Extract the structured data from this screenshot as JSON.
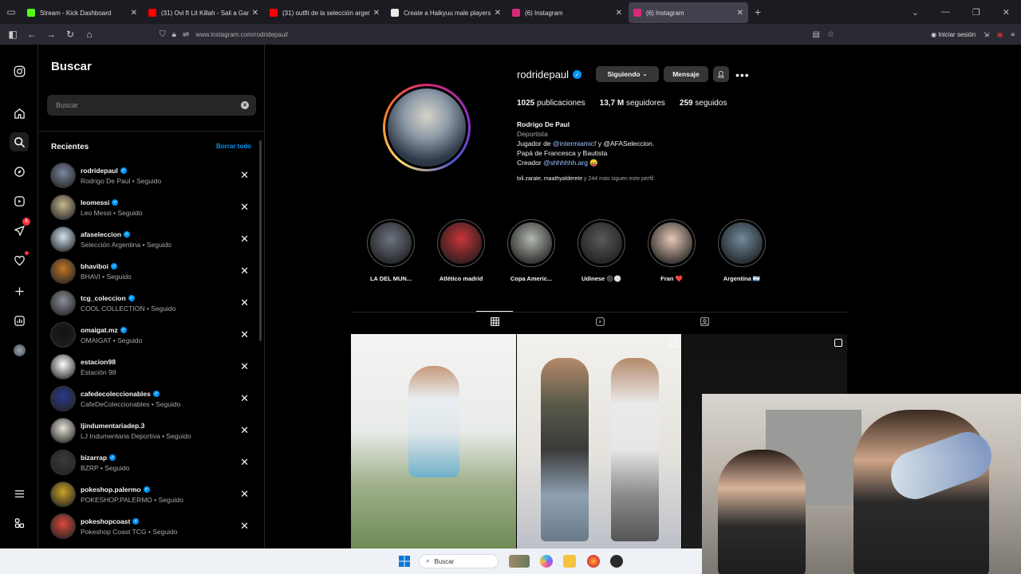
{
  "browser": {
    "tabs": [
      {
        "title": "Stream - Kick Dashboard",
        "color": "#53fc18",
        "active": false
      },
      {
        "title": "(31) Ovi ft Lit Killah - Sali a Gan",
        "color": "#ff0000",
        "active": false
      },
      {
        "title": "(31) outfit de la selección argen",
        "color": "#ff0000",
        "active": false
      },
      {
        "title": "Create a Haikyuu male players:",
        "color": "#e8e8e8",
        "active": false
      },
      {
        "title": "(6) Instagram",
        "color": "#d62976",
        "active": false
      },
      {
        "title": "(6) Instagram",
        "color": "#d62976",
        "active": true
      }
    ],
    "url": "www.instagram.com/rodridepaul/",
    "signin_label": "Iniciar sesión"
  },
  "search": {
    "title": "Buscar",
    "placeholder": "Buscar",
    "recent_heading": "Recientes",
    "clear_all": "Borrar todo",
    "items": [
      {
        "user": "rodridepaul",
        "sub": "Rodrigo De Paul • Seguido",
        "verified": true,
        "color": "#7a86a0"
      },
      {
        "user": "leomessi",
        "sub": "Leo Messi • Seguido",
        "verified": true,
        "color": "#c9b98f"
      },
      {
        "user": "afaseleccion",
        "sub": "Selección Argentina • Seguido",
        "verified": true,
        "color": "#cfe3f2"
      },
      {
        "user": "bhaviboi",
        "sub": "BHAVI • Seguido",
        "verified": true,
        "color": "#c2762b"
      },
      {
        "user": "tcg_coleccion",
        "sub": "COOL COLLECTION • Seguido",
        "verified": true,
        "color": "#8a8f99"
      },
      {
        "user": "omaigat.mz",
        "sub": "OMAIGAT • Seguido",
        "verified": true,
        "color": "#111111"
      },
      {
        "user": "estacion98",
        "sub": "Estación 98",
        "verified": false,
        "color": "#ffffff"
      },
      {
        "user": "cafedecoleccionables",
        "sub": "CafeDeColeccionables • Seguido",
        "verified": true,
        "color": "#2b3a8a"
      },
      {
        "user": "ljindumentariadep.3",
        "sub": "LJ Indumentaria Deportiva • Seguido",
        "verified": false,
        "color": "#e8e4d8"
      },
      {
        "user": "bizarrap",
        "sub": "BZRP • Seguido",
        "verified": true,
        "color": "#3a3a3a"
      },
      {
        "user": "pokeshop.palermo",
        "sub": "POKESHOP.PALERMO • Seguido",
        "verified": true,
        "color": "#c9a227"
      },
      {
        "user": "pokeshopcoast",
        "sub": "Pokeshop Coast TCG • Seguido",
        "verified": true,
        "color": "#d94a3a"
      }
    ]
  },
  "rail": {
    "notifications_badge": "6"
  },
  "profile": {
    "username": "rodridepaul",
    "following_label": "Siguiendo",
    "message_label": "Mensaje",
    "posts_count": "1025",
    "posts_label": "publicaciones",
    "followers_count": "13,7 M",
    "followers_label": "seguidores",
    "following_count": "259",
    "following_word": "seguidos",
    "name": "Rodrigo De Paul",
    "category": "Deportista",
    "bio_line1_prefix": "Jugador de ",
    "bio_line1_mention": "@intermiamicf",
    "bio_line1_suffix": " y @AFASeleccion.",
    "bio_line2": "Papá de Francesca y Bautista",
    "bio_line3_prefix": "Creador ",
    "bio_line3_mention": "@shhhhhh.arg",
    "bio_line3_emoji": "😛",
    "followed_by_names": "loli.zarate, maathyalderete",
    "followed_by_rest": " y 244 más siguen este perfil",
    "highlights": [
      {
        "label": "LA DEL MUN...",
        "color": "#6d7480"
      },
      {
        "label": "Atlético madrid",
        "color": "#c9353a"
      },
      {
        "label": "Copa Americ...",
        "color": "#b3b8b0"
      },
      {
        "label": "Udinese ⚫⚪",
        "color": "#5a5a5a"
      },
      {
        "label": "Fran ❤️",
        "color": "#e6c8b8"
      },
      {
        "label": "Argentina 🇦🇷",
        "color": "#6f8a9e"
      }
    ]
  },
  "taskbar": {
    "search_label": "Buscar"
  }
}
